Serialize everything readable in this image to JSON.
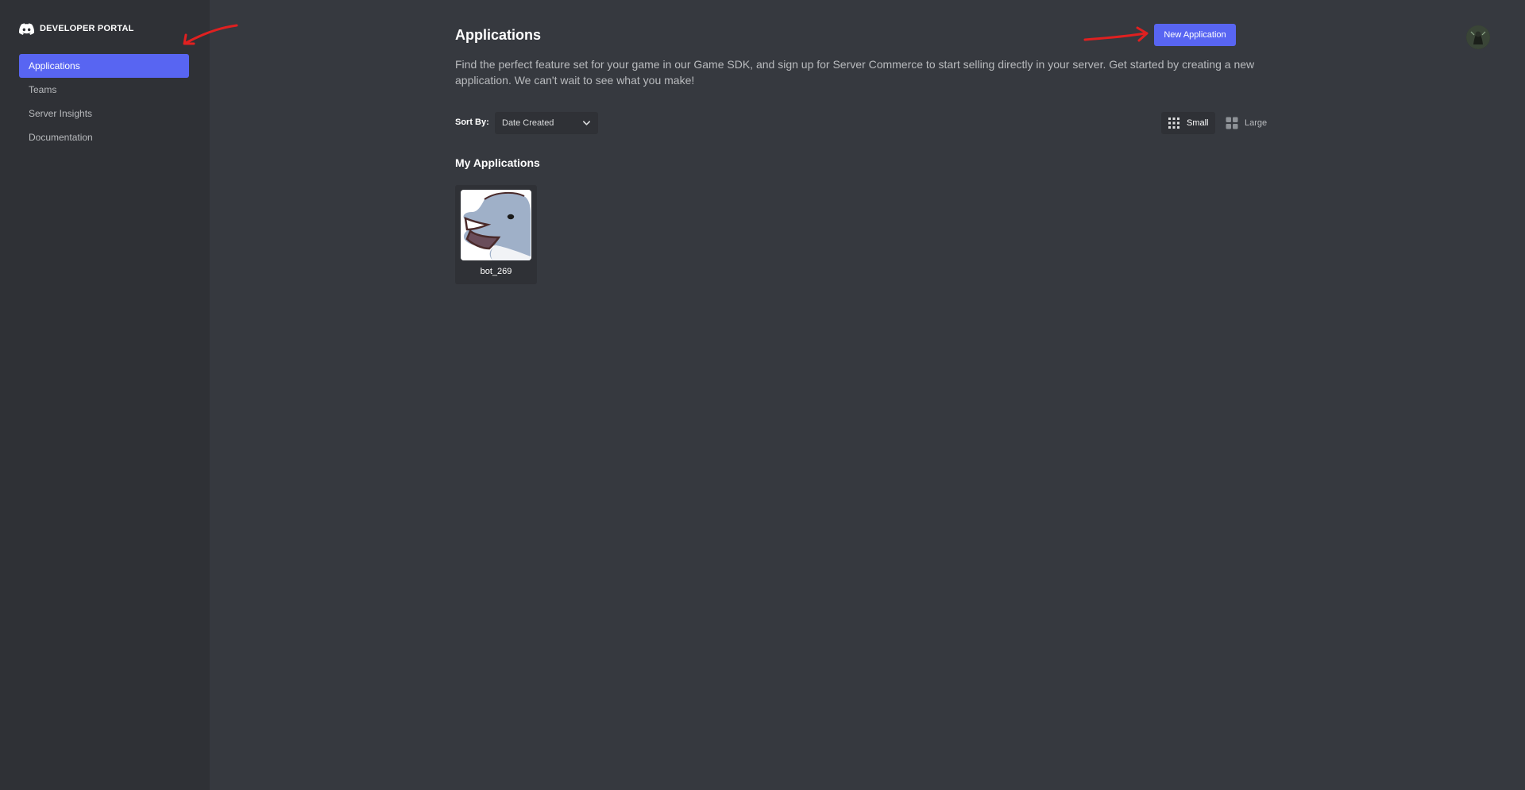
{
  "brand": {
    "label": "DEVELOPER PORTAL",
    "icon": "discord-logo-icon"
  },
  "sidebar": {
    "items": [
      {
        "label": "Applications",
        "active": true
      },
      {
        "label": "Teams",
        "active": false
      },
      {
        "label": "Server Insights",
        "active": false
      },
      {
        "label": "Documentation",
        "active": false
      }
    ]
  },
  "header": {
    "title": "Applications",
    "description": "Find the perfect feature set for your game in our Game SDK, and sign up for Server Commerce to start selling directly in your server. Get started by creating a new application. We can't wait to see what you make!",
    "new_button_label": "New Application"
  },
  "toolbar": {
    "sort_label": "Sort By:",
    "sort_value": "Date Created",
    "view_small_label": "Small",
    "view_large_label": "Large",
    "selected_view": "Small"
  },
  "applications": {
    "section_title": "My Applications",
    "items": [
      {
        "name": "bot_269",
        "icon": "dolphin-avatar-icon"
      }
    ]
  },
  "colors": {
    "accent": "#5865f2",
    "background": "#36393f",
    "sidebar": "#2f3136",
    "annotation": "#e02020"
  }
}
